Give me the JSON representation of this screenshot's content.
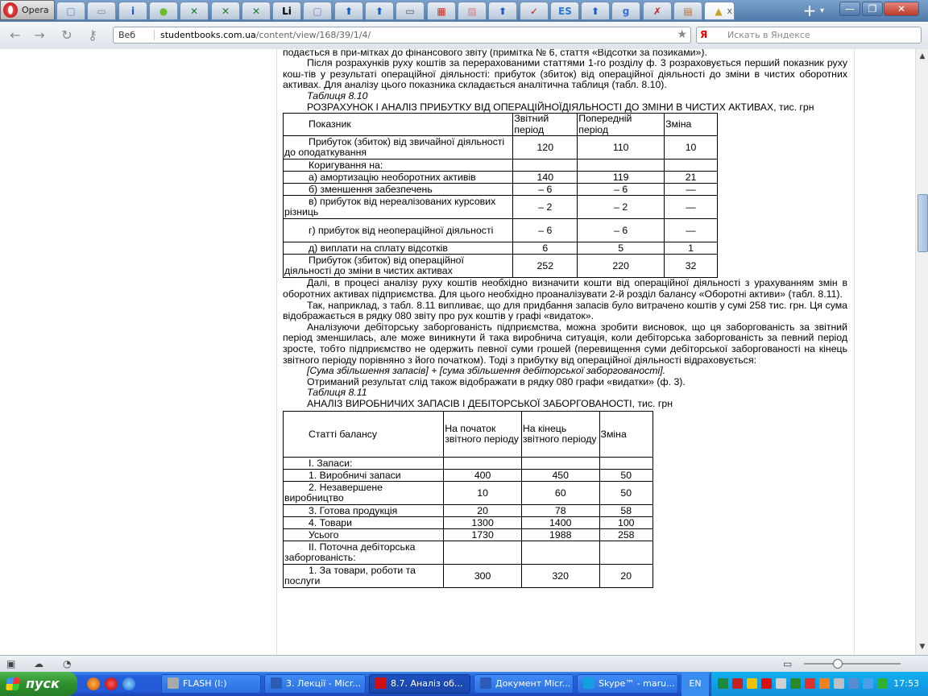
{
  "browser": {
    "menu_label": "Opera",
    "new_tab": "+",
    "tab_menu": "▾",
    "tabs": [
      {
        "icon": "page-icon",
        "glyph": "▢",
        "color": "#6a7fb0"
      },
      {
        "icon": "document-icon",
        "glyph": "▭",
        "color": "#888"
      },
      {
        "icon": "info-icon",
        "glyph": "i",
        "color": "#1a55c8"
      },
      {
        "icon": "apple-icon",
        "glyph": "●",
        "color": "#6cbf2c"
      },
      {
        "icon": "excel-icon",
        "glyph": "✕",
        "color": "#1f7a2a"
      },
      {
        "icon": "excel-icon",
        "glyph": "✕",
        "color": "#1f7a2a"
      },
      {
        "icon": "excel-icon",
        "glyph": "✕",
        "color": "#1f7a2a"
      },
      {
        "icon": "li-icon",
        "glyph": "Li",
        "color": "#000"
      },
      {
        "icon": "page-icon",
        "glyph": "▢",
        "color": "#8a6fc0"
      },
      {
        "icon": "upload-arrow-icon",
        "glyph": "⬆",
        "color": "#1a5bc8"
      },
      {
        "icon": "upload-arrow-icon",
        "glyph": "⬆",
        "color": "#1a5bc8"
      },
      {
        "icon": "document-icon",
        "glyph": "▭",
        "color": "#556"
      },
      {
        "icon": "red-book-icon",
        "glyph": "▦",
        "color": "#d03020"
      },
      {
        "icon": "chart-icon",
        "glyph": "▨",
        "color": "#d08080"
      },
      {
        "icon": "upload-arrow-icon",
        "glyph": "⬆",
        "color": "#1a5bc8"
      },
      {
        "icon": "check-icon",
        "glyph": "✓",
        "color": "#c02020"
      },
      {
        "icon": "es-icon",
        "glyph": "ES",
        "color": "#2a7ad0"
      },
      {
        "icon": "upload-arrow-icon",
        "glyph": "⬆",
        "color": "#1a5bc8"
      },
      {
        "icon": "google-icon",
        "glyph": "g",
        "color": "#3b6fd8"
      },
      {
        "icon": "x-icon",
        "glyph": "✗",
        "color": "#d01818"
      },
      {
        "icon": "books-icon",
        "glyph": "▤",
        "color": "#b86a2a"
      },
      {
        "icon": "graduation-cap-icon",
        "glyph": "▲",
        "color": "#c9a227",
        "active": true,
        "close": "x"
      }
    ],
    "window": {
      "minimize": "—",
      "maximize": "❐",
      "close": "✕"
    },
    "nav": {
      "back": "←",
      "forward": "→",
      "reload": "↻",
      "key": "⚷"
    },
    "address": {
      "security_label": "Веб",
      "host": "studentbooks.com.ua",
      "path": "/content/view/168/39/1/4/",
      "star": "★"
    },
    "search": {
      "engine": "Я",
      "placeholder": "Искать в Яндексе"
    }
  },
  "content": {
    "p0": "сумою реально сплачених відсотків, необхідно додати до операційного прибутку. Необхідна інформація до цієї статті подається в при-мітках до фінансового звіту (примітка № 6, стаття «Відсотки за позиками»).",
    "p1": "Після розрахунків руху коштів за перерахованими статтями 1-го розділу ф. 3 розраховується перший показник руху кош-тів у результаті операційної діяльності: прибуток (збиток) від операційної діяльності до зміни в чистих оборотних активах. Для аналізу цього показника складається аналітична таблиця (табл. 8.10).",
    "table1_caption": "Таблиця 8.10",
    "table1_title": "РОЗРАХУНОК І АНАЛІЗ ПРИБУТКУ ВІД ОПЕРАЦІЙНОЇДІЯЛЬНОСТІ ДО ЗМІНИ В ЧИСТИХ АКТИВАХ, тис. грн",
    "table1": {
      "headers": [
        "Показник",
        "Звітний період",
        "Попередній період",
        "Зміна"
      ],
      "rows": [
        [
          "Прибуток (збиток) від звичайної діяльності до оподаткування",
          "120",
          "110",
          "10"
        ],
        [
          "Коригування на:",
          "",
          "",
          ""
        ],
        [
          "а) амортизацію необоротних активів",
          "140",
          "119",
          "21"
        ],
        [
          "б) зменшення забезпечень",
          "– 6",
          "– 6",
          "—"
        ],
        [
          "в) прибуток від нереалізованих курсових різниць",
          "– 2",
          "– 2",
          "—"
        ],
        [
          "г) прибуток від неопераційної діяльності",
          "– 6",
          "– 6",
          "—"
        ],
        [
          "д) виплати на сплату відсотків",
          "6",
          "5",
          "1"
        ],
        [
          "Прибуток (збиток) від операційної діяльності до зміни в чистих активах",
          "252",
          "220",
          "32"
        ]
      ]
    },
    "p2": "Далі, в процесі аналізу руху коштів необхідно визначити кошти від операційної діяльності з урахуванням змін в оборотних активах підприємства. Для цього необхідно проаналізувати 2-й розділ балансу «Оборотні активи» (табл. 8.11).",
    "p3": "Так, наприклад, з табл. 8.11 випливає, що для придбання запасів було витрачено коштів у сумі 258 тис. грн. Ця сума відображається в рядку 080 звіту про рух коштів у графі «видаток».",
    "p4": "Аналізуючи дебіторську заборгованість підприємства, можна зробити висновок, що ця заборгованість за звітний період зменшилась, але може виникнути й така виробнича ситуація, коли дебіторська заборгованість за певний період зросте, тобто підприємство не одержить певної суми грошей (перевищення суми дебіторської заборгованості на кінець звітного періоду порівняно з його початком). Тоді з прибутку від операційної діяльності відраховується:",
    "formula": "[Сума збільшення запасів] + [сума збільшення дебіторської заборгованості].",
    "p5": "Отриманий результат слід також відображати в рядку 080 графи «видатки» (ф. 3).",
    "table2_caption": "Таблиця 8.11",
    "table2_title": "АНАЛІЗ ВИРОБНИЧИХ ЗАПАСІВ І ДЕБІТОРСЬКОЇ ЗАБОРГОВАНОСТІ, тис. грн",
    "table2": {
      "headers": [
        "Статті балансу",
        "На початок звітного періоду",
        "На кінець звітного періоду",
        "Зміна"
      ],
      "rows": [
        [
          "I. Запаси:",
          "",
          "",
          ""
        ],
        [
          "1. Виробничі запаси",
          "400",
          "450",
          "50"
        ],
        [
          "2. Незавершене виробництво",
          "10",
          "60",
          "50"
        ],
        [
          "3. Готова продукція",
          "20",
          "78",
          "58"
        ],
        [
          "4. Товари",
          "1300",
          "1400",
          "100"
        ],
        [
          "Усього",
          "1730",
          "1988",
          "258"
        ],
        [
          "II. Поточна дебіторська заборгованість:",
          "",
          "",
          ""
        ],
        [
          "1. За товари, роботи та послуги",
          "300",
          "320",
          "20"
        ]
      ]
    }
  },
  "taskbar": {
    "start": "пуск",
    "tasks": [
      {
        "label": "FLASH (I:)",
        "color": "#aaa"
      },
      {
        "label": "3. Лекції - Micr...",
        "color": "#2a5cb8"
      },
      {
        "label": "8.7. Аналіз об...",
        "color": "#d01010"
      },
      {
        "label": "Документ Micr...",
        "color": "#2a5cb8"
      },
      {
        "label": "Skype™ - maru...",
        "color": "#13a0e0"
      }
    ],
    "lang": "EN",
    "clock": "17:53"
  }
}
